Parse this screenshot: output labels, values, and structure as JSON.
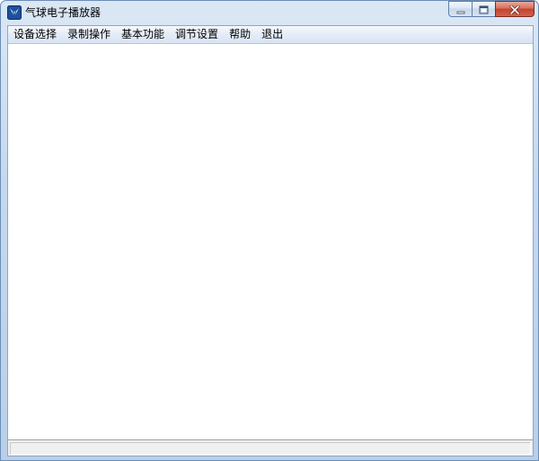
{
  "window": {
    "title": "气球电子播放器",
    "icon": "balloon-app-icon",
    "caption_buttons": [
      "minimize-icon",
      "maximize-icon",
      "close-icon"
    ]
  },
  "menubar": {
    "items": [
      {
        "label": "设备选择"
      },
      {
        "label": "录制操作"
      },
      {
        "label": "基本功能"
      },
      {
        "label": "调节设置"
      },
      {
        "label": "帮助"
      },
      {
        "label": "退出"
      }
    ]
  },
  "statusbar": {
    "text": ""
  },
  "colors": {
    "frame": "#c5d8ee",
    "close_button": "#c3432c",
    "client_background": "#ffffff"
  }
}
